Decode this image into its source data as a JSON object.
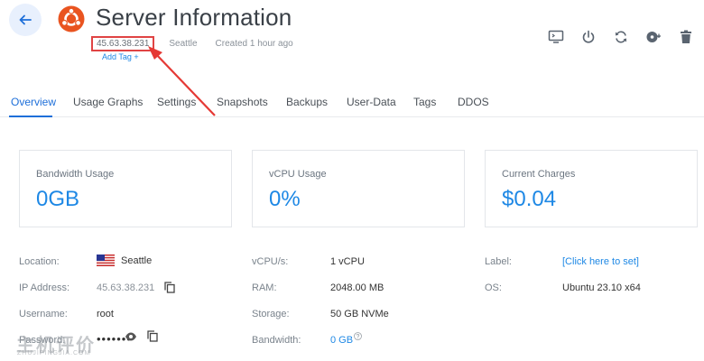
{
  "header": {
    "title": "Server Information",
    "ip": "45.63.38.231",
    "location": "Seattle",
    "created": "Created 1 hour ago",
    "add_tag": "Add Tag +"
  },
  "toolbar": {
    "items": [
      "console-icon",
      "power-icon",
      "restart-icon",
      "reinstall-icon",
      "trash-icon"
    ]
  },
  "tabs": [
    "Overview",
    "Usage Graphs",
    "Settings",
    "Snapshots",
    "Backups",
    "User-Data",
    "Tags",
    "DDOS"
  ],
  "cards": [
    {
      "label": "Bandwidth Usage",
      "value": "0GB"
    },
    {
      "label": "vCPU Usage",
      "value": "0%"
    },
    {
      "label": "Current Charges",
      "value": "$0.04"
    }
  ],
  "info": {
    "location_label": "Location:",
    "location_value": "Seattle",
    "ip_label": "IP Address:",
    "ip_value": "45.63.38.231",
    "username_label": "Username:",
    "username_value": "root",
    "password_label": "Password:",
    "password_value": "•••••••",
    "vcpu_label": "vCPU/s:",
    "vcpu_value": "1 vCPU",
    "ram_label": "RAM:",
    "ram_value": "2048.00 MB",
    "storage_label": "Storage:",
    "storage_value": "50 GB NVMe",
    "bandwidth_label": "Bandwidth:",
    "bandwidth_value": "0 GB",
    "label_label": "Label:",
    "label_value": "[Click here to set]",
    "os_label": "OS:",
    "os_value": "Ubuntu 23.10 x64"
  },
  "watermark": {
    "text": "主机评价",
    "sub": "ZHUJIPINGJIA.COM"
  },
  "colors": {
    "accent": "#1e88e5",
    "highlight": "#e04444",
    "ubuntu": "#e95420"
  }
}
